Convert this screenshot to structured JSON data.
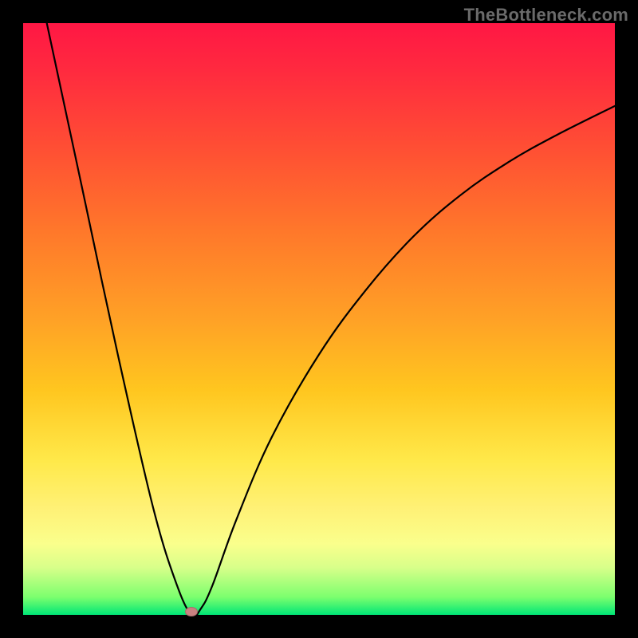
{
  "watermark": "TheBottleneck.com",
  "chart_data": {
    "type": "line",
    "title": "",
    "xlabel": "",
    "ylabel": "",
    "xlim": [
      0,
      100
    ],
    "ylim": [
      0,
      100
    ],
    "series": [
      {
        "name": "curve",
        "points": [
          {
            "x": 4,
            "y": 100
          },
          {
            "x": 10,
            "y": 72
          },
          {
            "x": 16,
            "y": 44
          },
          {
            "x": 22,
            "y": 18
          },
          {
            "x": 26,
            "y": 5
          },
          {
            "x": 28.5,
            "y": 0
          },
          {
            "x": 30,
            "y": 1
          },
          {
            "x": 32,
            "y": 5
          },
          {
            "x": 36,
            "y": 16
          },
          {
            "x": 42,
            "y": 30
          },
          {
            "x": 50,
            "y": 44
          },
          {
            "x": 58,
            "y": 55
          },
          {
            "x": 66,
            "y": 64
          },
          {
            "x": 74,
            "y": 71
          },
          {
            "x": 82,
            "y": 76.5
          },
          {
            "x": 90,
            "y": 81
          },
          {
            "x": 100,
            "y": 86
          }
        ]
      }
    ],
    "marker": {
      "x": 28.5,
      "y": 0.5,
      "color": "#c98181"
    },
    "background_gradient": {
      "top": "#ff1744",
      "bottom": "#00e676"
    }
  }
}
